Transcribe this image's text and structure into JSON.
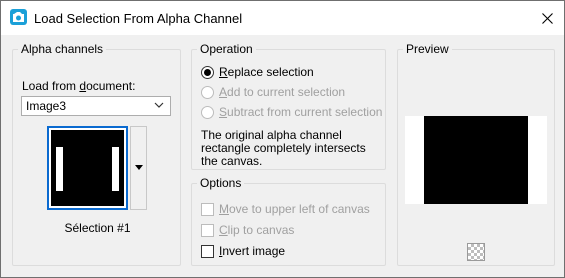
{
  "window": {
    "title": "Load Selection From Alpha Channel",
    "close_icon": "close-icon",
    "app_icon": "app-icon"
  },
  "alpha_channels": {
    "label": "Alpha channels",
    "load_label_underlined": "d",
    "load_label_before": "Load from ",
    "load_label_after": "ocument:",
    "document_value": "Image3",
    "channel_name": "Sélection #1"
  },
  "operation": {
    "label": "Operation",
    "options": [
      {
        "underline": "R",
        "rest": "eplace selection",
        "checked": true,
        "disabled": false
      },
      {
        "underline": "A",
        "rest": "dd to current selection",
        "checked": false,
        "disabled": true
      },
      {
        "underline": "S",
        "rest": "ubtract from current selection",
        "checked": false,
        "disabled": true
      }
    ],
    "description": "The original alpha channel rectangle completely intersects the canvas."
  },
  "options": {
    "label": "Options",
    "items": [
      {
        "underline": "M",
        "rest": "ove to upper left of canvas",
        "checked": false,
        "disabled": true
      },
      {
        "underline": "C",
        "rest": "lip to canvas",
        "checked": false,
        "disabled": true
      },
      {
        "underline": "I",
        "rest": "nvert image",
        "checked": false,
        "disabled": false
      }
    ]
  },
  "preview": {
    "label": "Preview"
  },
  "colors": {
    "accent": "#0a6ad0",
    "app_icon": "#1ba0d8"
  }
}
